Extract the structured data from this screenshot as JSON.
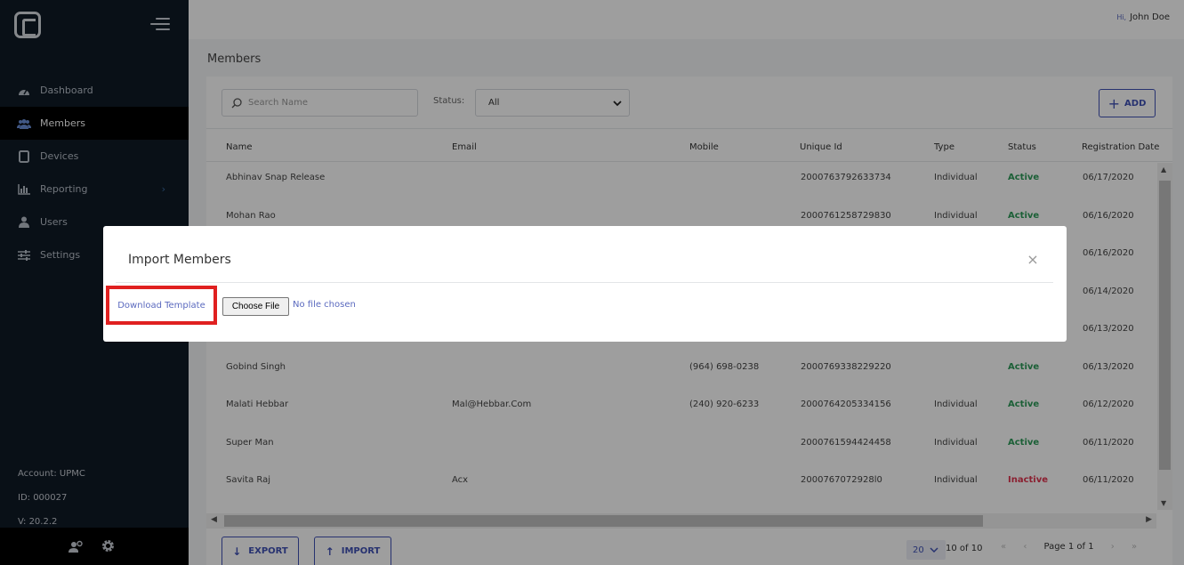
{
  "sidebar": {
    "items": [
      {
        "label": "Dashboard"
      },
      {
        "label": "Members"
      },
      {
        "label": "Devices"
      },
      {
        "label": "Reporting"
      },
      {
        "label": "Users"
      },
      {
        "label": "Settings"
      }
    ],
    "account": "Account: UPMC",
    "id": "ID: 000027",
    "version": "V: 20.2.2"
  },
  "header": {
    "hi": "Hi,",
    "user": "John Doe"
  },
  "page": {
    "title": "Members"
  },
  "search": {
    "placeholder": "Search Name"
  },
  "filter": {
    "label": "Status:",
    "value": "All"
  },
  "toolbar": {
    "add_label": "ADD"
  },
  "table": {
    "columns": [
      "Name",
      "Email",
      "Mobile",
      "Unique Id",
      "Type",
      "Status",
      "Registration Date"
    ],
    "rows": [
      {
        "name": "Abhinav Snap Release",
        "email": "",
        "mobile": "",
        "uid": "2000763792633734",
        "type": "Individual",
        "status": "Active",
        "date": "06/17/2020"
      },
      {
        "name": "Mohan Rao",
        "email": "",
        "mobile": "",
        "uid": "2000761258729830",
        "type": "Individual",
        "status": "Active",
        "date": "06/16/2020"
      },
      {
        "name": "",
        "email": "",
        "mobile": "",
        "uid": "",
        "type": "",
        "status": "",
        "date": "06/16/2020"
      },
      {
        "name": "",
        "email": "",
        "mobile": "",
        "uid": "",
        "type": "",
        "status": "",
        "date": "06/14/2020"
      },
      {
        "name": "",
        "email": "",
        "mobile": "",
        "uid": "",
        "type": "",
        "status": "",
        "date": "06/13/2020"
      },
      {
        "name": "Gobind Singh",
        "email": "",
        "mobile": "(964) 698-0238",
        "uid": "2000769338229220",
        "type": "",
        "status": "Active",
        "date": "06/13/2020"
      },
      {
        "name": "Malati Hebbar",
        "email": "Mal@Hebbar.Com",
        "mobile": "(240) 920-6233",
        "uid": "2000764205334156",
        "type": "Individual",
        "status": "Active",
        "date": "06/12/2020"
      },
      {
        "name": "Super Man",
        "email": "",
        "mobile": "",
        "uid": "2000761594424458",
        "type": "Individual",
        "status": "Active",
        "date": "06/11/2020"
      },
      {
        "name": "Savita Raj",
        "email": "Acx",
        "mobile": "",
        "uid": "2000767072928l0",
        "type": "Individual",
        "status": "Inactive",
        "date": "06/11/2020"
      }
    ]
  },
  "footer": {
    "export_label": "EXPORT",
    "import_label": "IMPORT",
    "per_page": "20",
    "range": "10 of 10",
    "page_label": "Page 1 of 1"
  },
  "modal": {
    "title": "Import Members",
    "download_label": "Download Template",
    "choose_file_label": "Choose File",
    "no_file_label": "No file chosen"
  },
  "colors": {
    "sidebar_bg": "#0f1a26",
    "accent": "#3f51b5",
    "active_status": "#2e9c5a",
    "inactive_status": "#e0344f",
    "highlight": "#e02020"
  }
}
